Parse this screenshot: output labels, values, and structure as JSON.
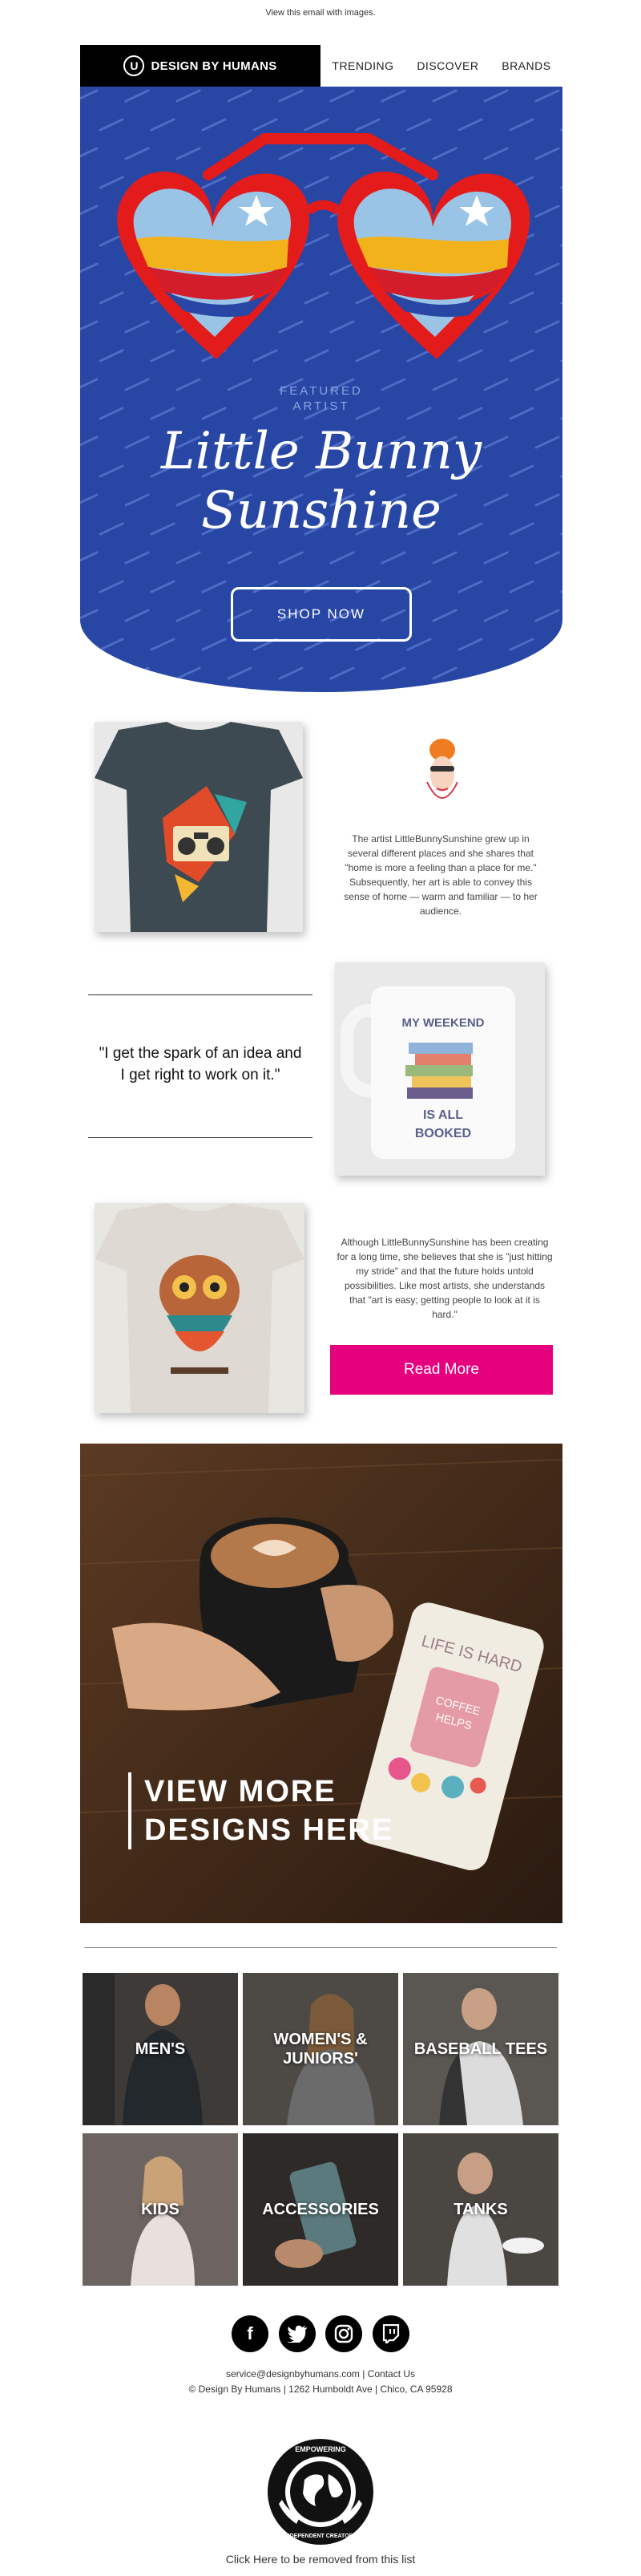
{
  "preheader": "View this email with images.",
  "nav": {
    "logo": "DESIGN BY HUMANS",
    "links": [
      "TRENDING",
      "DISCOVER",
      "BRANDS"
    ]
  },
  "hero": {
    "featured": "FEATURED",
    "artist": "ARTIST",
    "title_line1": "Little Bunny",
    "title_line2": "Sunshine",
    "cta": "SHOP NOW",
    "bg_color": "#2847a5"
  },
  "section1": {
    "text": "The artist LittleBunnySunshine grew up in several different places and she shares that \"home is more a feeling than a place for me.\" Subsequently, her art is able to convey this sense of home — warm and familiar — to her audience."
  },
  "quote": {
    "line1": "\"I get the spark of an idea and",
    "line2": "I get right to work on it.\""
  },
  "mug": {
    "line1": "MY WEEKEND",
    "line2": "IS ALL",
    "line3": "BOOKED"
  },
  "section3": {
    "text": "Although LittleBunnySunshine has been creating for a long time, she believes that she is \"just hitting my stride\" and that the future holds untold possibilities. Like most artists, she understands that \"art is easy; getting people to look at it is hard.\"",
    "cta": "Read More",
    "cta_color": "#e6007e"
  },
  "coffee": {
    "line1": "VIEW MORE",
    "line2": "DESIGNS HERE",
    "phone_text": "LIFE IS HARD",
    "cup_text1": "COFFEE",
    "cup_text2": "HELPS"
  },
  "categories": [
    "MEN'S",
    "WOMEN'S & JUNIORS'",
    "BASEBALL TEES",
    "KIDS",
    "ACCESSORIES",
    "TANKS"
  ],
  "social": [
    "facebook-icon",
    "twitter-icon",
    "instagram-icon",
    "twitch-icon"
  ],
  "footer": {
    "contact": "service@designbyhumans.com | Contact Us",
    "address": "© Design By Humans | 1262 Humboldt Ave | Chico, CA 95928",
    "badge_top": "EMPOWERING",
    "badge_bottom": "INDEPENDENT CREATORS",
    "unsubscribe": "Click Here to be removed from this list"
  }
}
